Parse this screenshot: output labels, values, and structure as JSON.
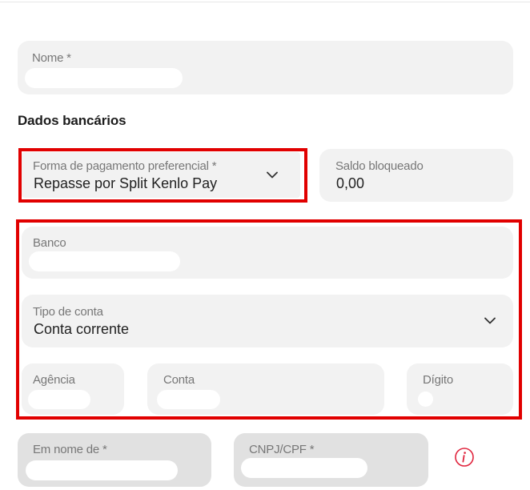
{
  "form": {
    "name": {
      "label": "Nome *"
    },
    "bank_section_title": "Dados bancários",
    "payment_method": {
      "label": "Forma de pagamento preferencial *",
      "value": "Repasse por Split Kenlo Pay"
    },
    "blocked_balance": {
      "label": "Saldo bloqueado",
      "value": "0,00"
    },
    "bank": {
      "label": "Banco"
    },
    "account_type": {
      "label": "Tipo de conta",
      "value": "Conta corrente"
    },
    "agency": {
      "label": "Agência"
    },
    "account": {
      "label": "Conta"
    },
    "digit": {
      "label": "Dígito"
    },
    "holder_name": {
      "label": "Em nome de *"
    },
    "holder_document": {
      "label": "CNPJ/CPF *"
    }
  },
  "icons": {
    "chevron": "chevron-down-icon",
    "info": "info-icon"
  },
  "colors": {
    "highlight": "#e10000",
    "info_icon": "#e0243d",
    "field_bg": "#f2f2f2",
    "disabled_bg": "#e1e1e1"
  }
}
